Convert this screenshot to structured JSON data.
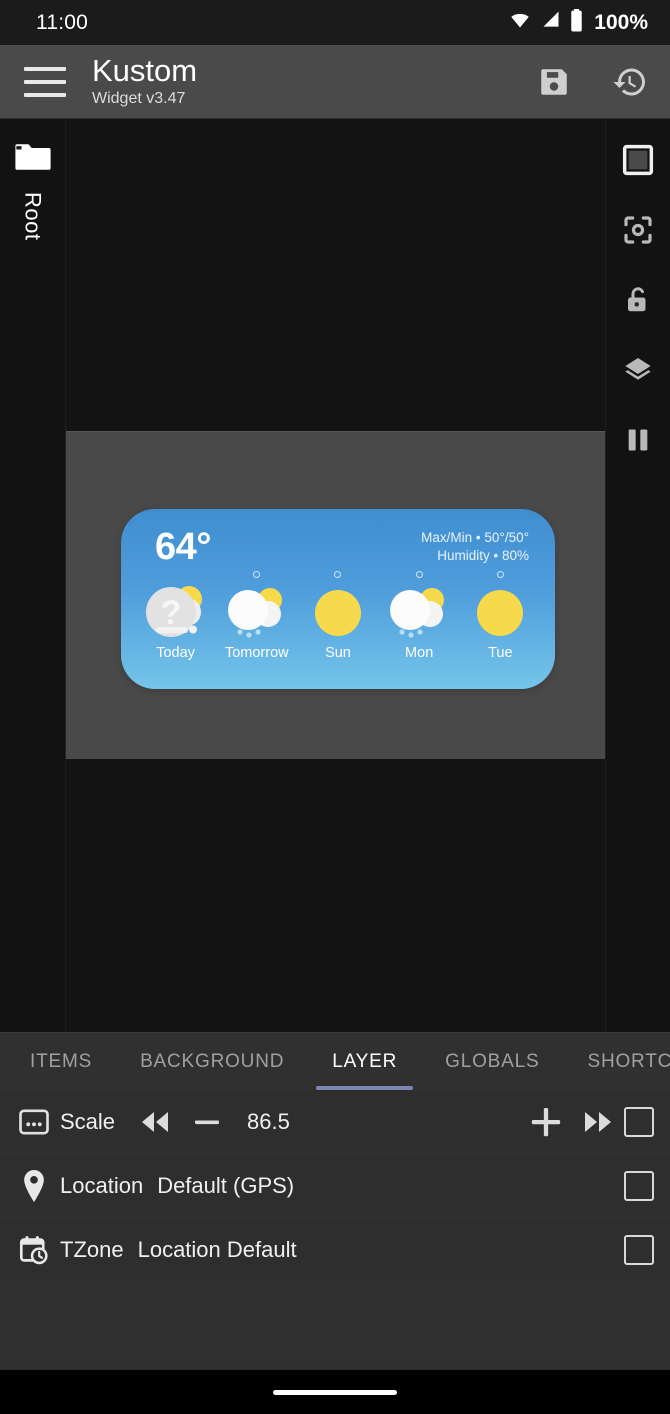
{
  "statusbar": {
    "time": "11:00",
    "battery": "100%",
    "icons": [
      "wifi-icon",
      "signal-icon",
      "battery-icon"
    ]
  },
  "appbar": {
    "menu_icon": "hamburger-menu-icon",
    "title": "Kustom",
    "subtitle": "Widget v3.47",
    "save_icon": "save-floppy-icon",
    "history_icon": "history-restore-icon"
  },
  "left_rail": {
    "folder_icon": "folder-icon",
    "label": "Root"
  },
  "right_rail": {
    "items": [
      {
        "name": "crop-square-icon",
        "label": "Resize"
      },
      {
        "name": "center-focus-icon",
        "label": "Center"
      },
      {
        "name": "unlock-icon",
        "label": "Lock"
      },
      {
        "name": "layers-icon",
        "label": "Layers"
      },
      {
        "name": "pause-icon",
        "label": "Pause"
      }
    ]
  },
  "widget": {
    "temperature": "64°",
    "maxmin": "Max/Min • 50°/50°",
    "humidity": "Humidity • 80%",
    "bg_color_top": "#3f8ed0",
    "bg_color_bottom": "#74c4ea",
    "forecast": [
      {
        "label": "Today",
        "icon": "weather-unknown-icon",
        "degree_dot": false
      },
      {
        "label": "Tomorrow",
        "icon": "weather-rain-sun-icon",
        "degree_dot": true
      },
      {
        "label": "Sun",
        "icon": "weather-sunny-icon",
        "degree_dot": true
      },
      {
        "label": "Mon",
        "icon": "weather-rain-sun-icon",
        "degree_dot": true
      },
      {
        "label": "Tue",
        "icon": "weather-sunny-icon",
        "degree_dot": true
      }
    ]
  },
  "tabs": [
    {
      "label": "ITEMS",
      "active": false
    },
    {
      "label": "BACKGROUND",
      "active": false
    },
    {
      "label": "LAYER",
      "active": true
    },
    {
      "label": "GLOBALS",
      "active": false
    },
    {
      "label": "SHORTCUTS",
      "active": false
    }
  ],
  "tab_accent": "#7b86b2",
  "rows": [
    {
      "icon": "scale-icon",
      "label": "Scale",
      "value": "86.5",
      "type": "stepper",
      "controls": {
        "fast_rewind": "fast-rewind-icon",
        "minus": "minus-icon",
        "plus": "plus-icon",
        "fast_forward": "fast-forward-icon"
      },
      "checkbox": false
    },
    {
      "icon": "location-pin-icon",
      "label": "Location",
      "value": "Default (GPS)",
      "type": "value",
      "checkbox": false
    },
    {
      "icon": "calendar-clock-icon",
      "label": "TZone",
      "value": "Location Default",
      "type": "value",
      "checkbox": false
    }
  ],
  "navbar": {
    "pill": "home-gesture-pill"
  }
}
